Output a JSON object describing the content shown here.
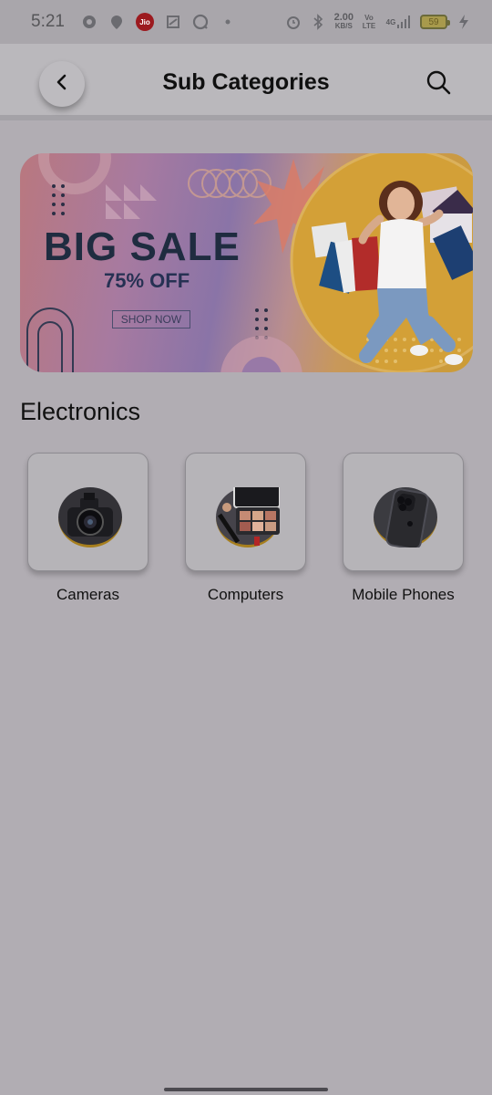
{
  "status_bar": {
    "time": "5:21",
    "jio": "Jio",
    "net_speed_value": "2.00",
    "net_speed_unit": "KB/S",
    "volte": "Vo LTE",
    "network": "4G",
    "battery": "59"
  },
  "header": {
    "title": "Sub Categories"
  },
  "banner": {
    "title": "BIG SALE",
    "subtitle": "75% OFF",
    "cta": "SHOP NOW"
  },
  "section": {
    "title": "Electronics",
    "items": [
      {
        "label": "Cameras"
      },
      {
        "label": "Computers"
      },
      {
        "label": "Mobile Phones"
      }
    ]
  },
  "colors": {
    "accent_gold": "#cc9c34",
    "banner_text": "#1f2c40"
  }
}
